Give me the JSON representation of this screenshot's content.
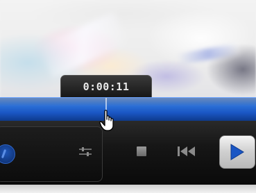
{
  "player": {
    "seek_tooltip": {
      "time": "0:00:11"
    },
    "colors": {
      "seekbar": "#2b6fd6",
      "control_background": "#161616",
      "play_button": "#1a56c4"
    },
    "controls": [
      {
        "name": "volume-knob",
        "icon": "volume-knob-icon"
      },
      {
        "name": "equalizer-button",
        "icon": "equalizer-icon"
      },
      {
        "name": "stop-button",
        "icon": "stop-icon"
      },
      {
        "name": "previous-button",
        "icon": "skip-back-icon"
      },
      {
        "name": "play-button",
        "icon": "play-icon"
      }
    ],
    "cursor": {
      "icon": "hand-pointer-icon"
    }
  }
}
